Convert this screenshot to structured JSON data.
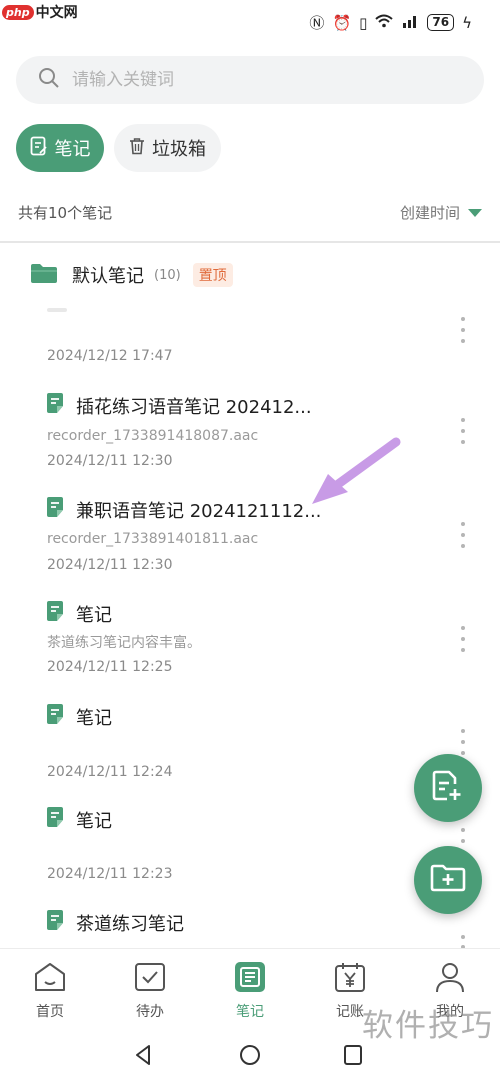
{
  "watermark_top": {
    "badge": "php",
    "text": "中文网"
  },
  "status": {
    "battery": "76"
  },
  "search": {
    "placeholder": "请输入关键词"
  },
  "filters": [
    {
      "label": "笔记",
      "icon": "note-edit-icon",
      "active": true
    },
    {
      "label": "垃圾箱",
      "icon": "trash-icon",
      "active": false
    }
  ],
  "summary": {
    "count_text": "共有10个笔记",
    "sort_label": "创建时间"
  },
  "folder": {
    "name": "默认笔记",
    "count": "(10)",
    "badge": "置顶"
  },
  "notes": [
    {
      "title": "",
      "subtitle": "",
      "date": "2024/12/12 17:47"
    },
    {
      "title": "插花练习语音笔记 202412...",
      "subtitle": "recorder_1733891418087.aac",
      "date": "2024/12/11 12:30"
    },
    {
      "title": "兼职语音笔记 2024121112...",
      "subtitle": "recorder_1733891401811.aac",
      "date": "2024/12/11 12:30"
    },
    {
      "title": "笔记",
      "subtitle": "茶道练习笔记内容丰富。",
      "date": "2024/12/11 12:25"
    },
    {
      "title": "笔记",
      "subtitle": "",
      "date": "2024/12/11 12:24"
    },
    {
      "title": "笔记",
      "subtitle": "",
      "date": "2024/12/11 12:23"
    },
    {
      "title": "茶道练习笔记",
      "subtitle": "",
      "date": ""
    }
  ],
  "nav": [
    {
      "label": "首页",
      "icon": "home-icon"
    },
    {
      "label": "待办",
      "icon": "todo-icon"
    },
    {
      "label": "笔记",
      "icon": "notes-icon"
    },
    {
      "label": "记账",
      "icon": "ledger-icon"
    },
    {
      "label": "我的",
      "icon": "profile-icon"
    }
  ],
  "watermark_bottom": "软件技巧",
  "colors": {
    "accent": "#4a9d77",
    "pin_badge": "#e06a3a",
    "annotation_arrow": "#c89be6"
  }
}
